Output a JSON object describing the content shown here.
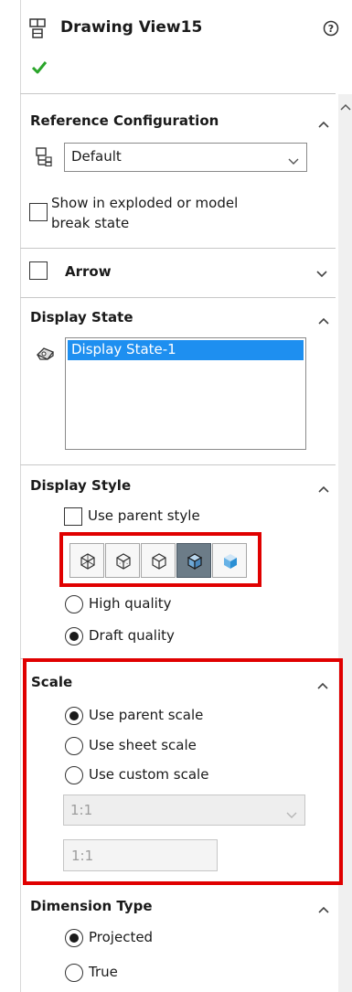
{
  "header": {
    "title": "Drawing View15",
    "icon": "drawing-view-icon",
    "help_icon": "help-icon",
    "ok_icon": "green-checkmark-icon"
  },
  "reference_configuration": {
    "title": "Reference Configuration",
    "config_value": "Default",
    "exploded_label": "Show in exploded or model break state",
    "exploded_line1": "Show in exploded or model",
    "exploded_line2": "break state",
    "exploded_checked": false
  },
  "arrow": {
    "label": "Arrow",
    "checked": false
  },
  "display_state": {
    "title": "Display State",
    "items": [
      "Display State-1"
    ],
    "selected": "Display State-1"
  },
  "display_style": {
    "title": "Display Style",
    "use_parent_label": "Use parent style",
    "use_parent_checked": false,
    "buttons": [
      {
        "name": "wireframe",
        "icon": "wireframe-icon",
        "active": false
      },
      {
        "name": "hidden-lines-visible",
        "icon": "hidden-lines-visible-icon",
        "active": false
      },
      {
        "name": "hidden-lines-removed",
        "icon": "hidden-lines-removed-icon",
        "active": false
      },
      {
        "name": "shaded-with-edges",
        "icon": "shaded-with-edges-icon",
        "active": true
      },
      {
        "name": "shaded",
        "icon": "shaded-icon",
        "active": false
      }
    ],
    "high_quality_label": "High quality",
    "draft_quality_label": "Draft quality",
    "quality_selected": "Draft quality"
  },
  "scale": {
    "title": "Scale",
    "options": [
      "Use parent scale",
      "Use sheet scale",
      "Use custom scale"
    ],
    "selected": "Use parent scale",
    "custom_scale_value": "1:1",
    "custom_scale_text": "1:1"
  },
  "dimension_type": {
    "title": "Dimension Type",
    "options": [
      "Projected",
      "True"
    ],
    "selected": "Projected"
  },
  "colors": {
    "highlight_box": "#e00000",
    "selection_blue": "#1e8ff0",
    "check_green": "#2aa52a"
  }
}
